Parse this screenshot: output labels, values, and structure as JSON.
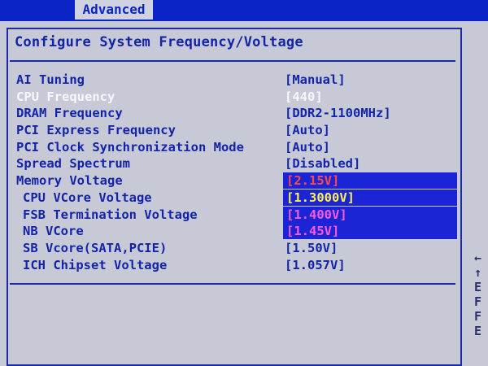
{
  "header": {
    "active_tab": "Advanced"
  },
  "panel": {
    "title": "Configure System Frequency/Voltage"
  },
  "settings": [
    {
      "label": "AI Tuning",
      "value": "[Manual]"
    },
    {
      "label": "CPU Frequency",
      "value": "[440]"
    },
    {
      "label": "DRAM Frequency",
      "value": "[DDR2-1100MHz]"
    },
    {
      "label": "PCI Express Frequency",
      "value": "[Auto]"
    },
    {
      "label": "PCI Clock Synchronization Mode",
      "value": "[Auto]"
    },
    {
      "label": "Spread Spectrum",
      "value": "[Disabled]"
    },
    {
      "label": "Memory Voltage",
      "value": "[2.15V]"
    },
    {
      "label": "CPU VCore Voltage",
      "value": "[1.3000V]"
    },
    {
      "label": "FSB Termination Voltage",
      "value": "[1.400V]"
    },
    {
      "label": "NB VCore",
      "value": "[1.45V]"
    },
    {
      "label": "SB Vcore(SATA,PCIE)",
      "value": "[1.50V]"
    },
    {
      "label": "ICH Chipset Voltage",
      "value": "[1.057V]"
    }
  ],
  "value_colors": {
    "memory_voltage": "#ff4a4a",
    "cpu_vcore_voltage": "#fff34a",
    "fsb_termination_voltage": "#ff5ad9",
    "nb_vcore": "#ff5ad9"
  },
  "help_keys": [
    "←",
    "↑",
    "E",
    "F",
    "F",
    "E"
  ]
}
